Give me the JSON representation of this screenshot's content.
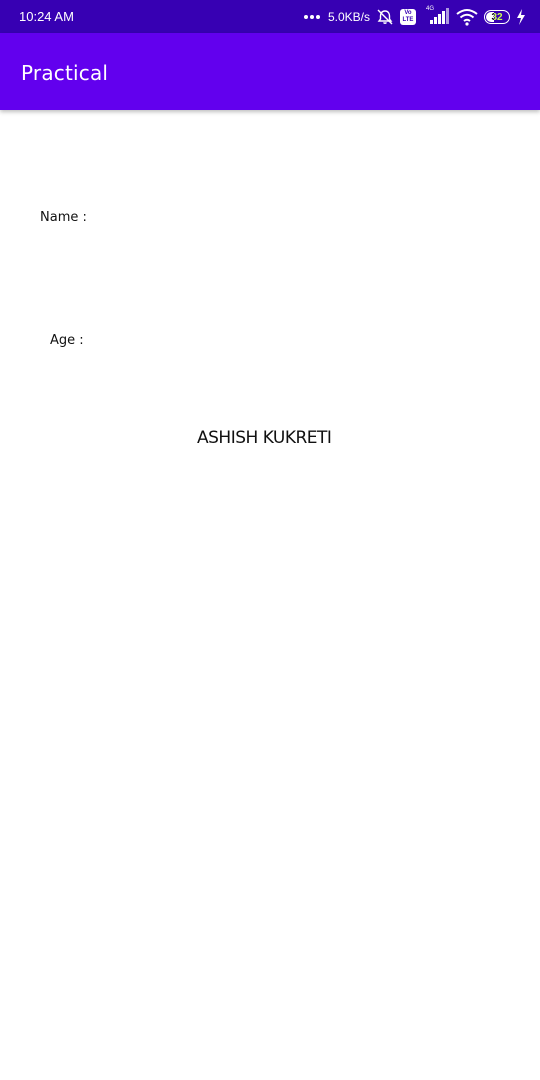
{
  "status_bar": {
    "time": "10:24 AM",
    "net_speed": "5.0KB/s",
    "volte_label": "Vo LTE",
    "network_gen": "4G",
    "battery_level": "32",
    "colors": {
      "background": "#3700B3",
      "text": "#ffffff"
    },
    "icons": [
      "more-dots-icon",
      "alarm-off-icon",
      "volte-icon",
      "cell-signal-icon",
      "wifi-icon",
      "battery-icon",
      "charging-bolt-icon"
    ]
  },
  "app_bar": {
    "title": "Practical",
    "color": "#6200EE"
  },
  "form": {
    "name_label": "Name :",
    "age_label": "Age :"
  },
  "footer": {
    "author": "ASHISH KUKRETI"
  }
}
